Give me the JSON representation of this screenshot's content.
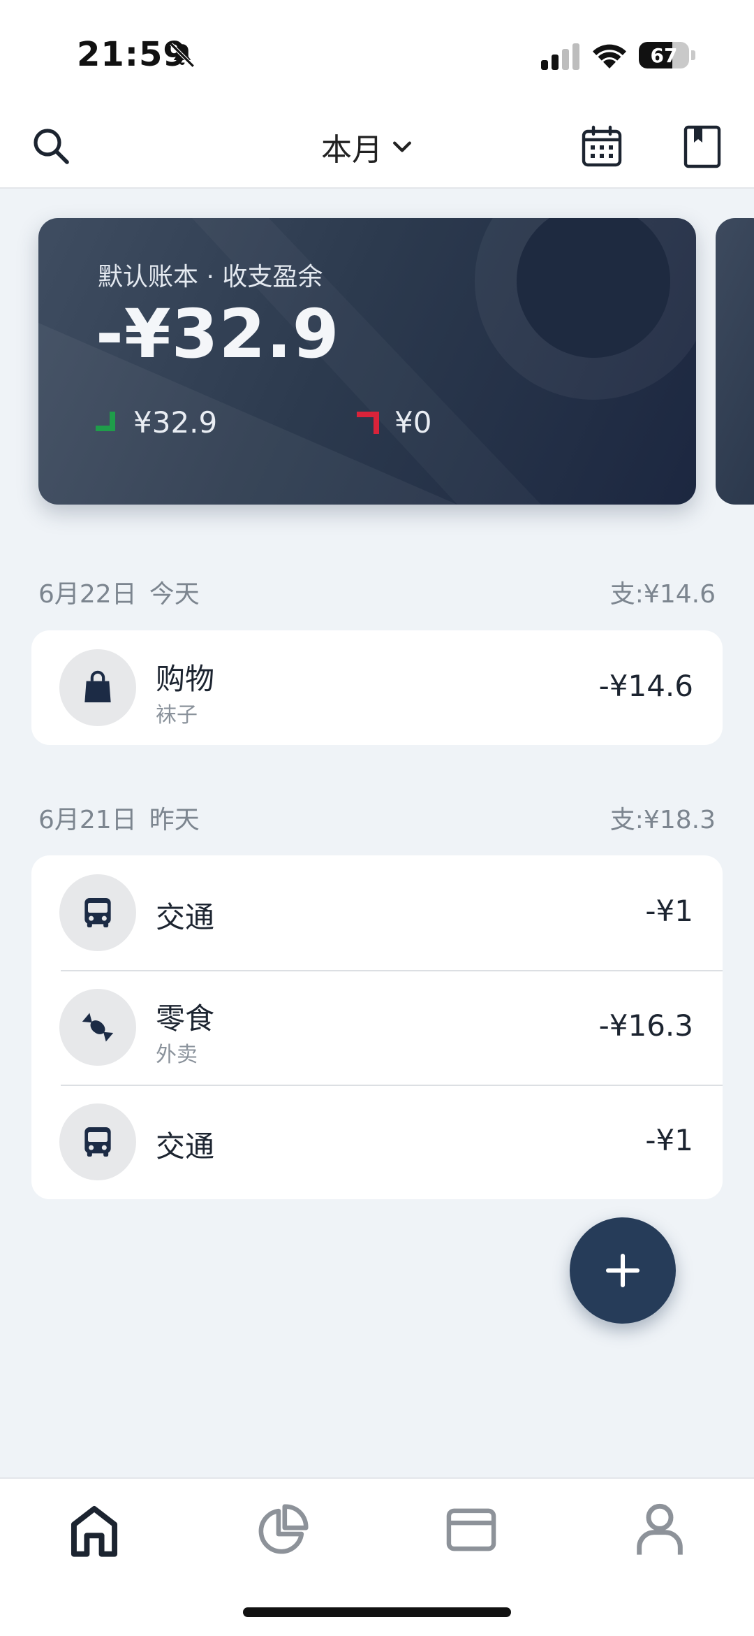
{
  "status": {
    "time": "21:59",
    "battery": "67",
    "battery_level": 0.67
  },
  "header": {
    "period": "本月"
  },
  "summary": {
    "subtitle": "默认账本 · 收支盈余",
    "balance": "-¥32.9",
    "expense": "¥32.9",
    "income": "¥0",
    "expense_color": "#1f9d4a",
    "income_color": "#d9233a"
  },
  "groups": [
    {
      "date": "6月22日",
      "relative": "今天",
      "total": "支:¥14.6",
      "items": [
        {
          "icon": "shopping-bag-icon",
          "category": "购物",
          "note": "袜子",
          "amount": "-¥14.6"
        }
      ]
    },
    {
      "date": "6月21日",
      "relative": "昨天",
      "total": "支:¥18.3",
      "items": [
        {
          "icon": "bus-icon",
          "category": "交通",
          "note": "",
          "amount": "-¥1"
        },
        {
          "icon": "candy-icon",
          "category": "零食",
          "note": "外卖",
          "amount": "-¥16.3"
        },
        {
          "icon": "bus-icon",
          "category": "交通",
          "note": "",
          "amount": "-¥1"
        }
      ]
    }
  ],
  "colors": {
    "accent": "#263c59",
    "background": "#eff3f7",
    "card": "#ffffff"
  }
}
